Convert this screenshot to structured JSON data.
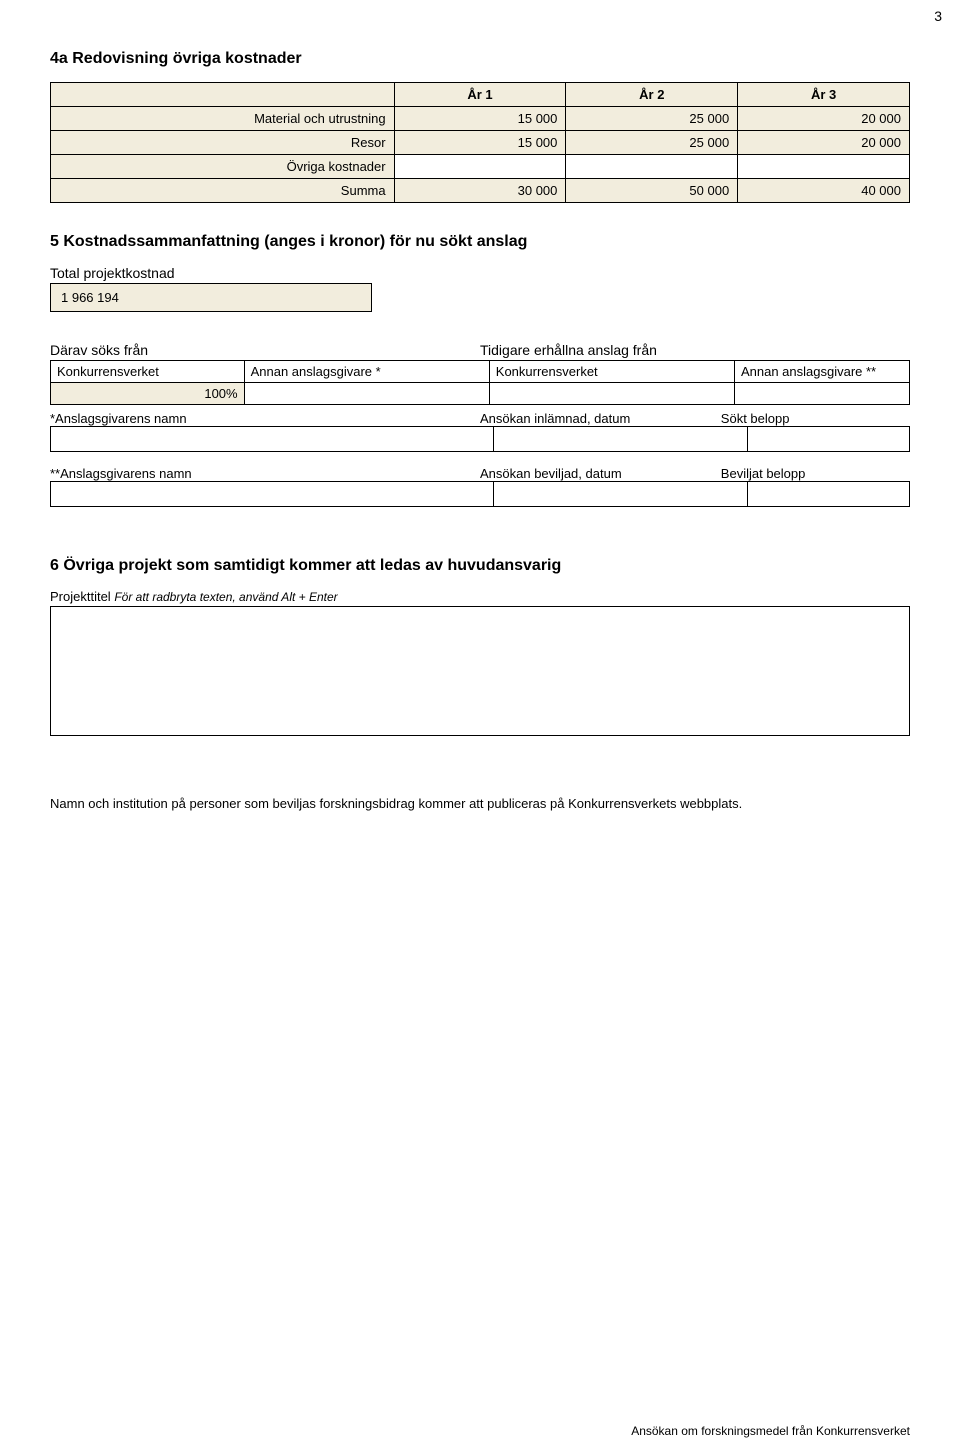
{
  "page_number": "3",
  "section_4a_title": "4a  Redovisning övriga kostnader",
  "cost_table": {
    "headers": [
      "År 1",
      "År 2",
      "År 3"
    ],
    "rows": [
      {
        "label": "Material och utrustning",
        "values": [
          "15 000",
          "25 000",
          "20 000"
        ]
      },
      {
        "label": "Resor",
        "values": [
          "15 000",
          "25 000",
          "20 000"
        ]
      },
      {
        "label": "Övriga kostnader",
        "values": [
          "",
          "",
          ""
        ]
      }
    ],
    "sum": {
      "label": "Summa",
      "values": [
        "30 000",
        "50 000",
        "40 000"
      ]
    }
  },
  "section_5_title": "5  Kostnadssammanfattning (anges i kronor) för nu sökt anslag",
  "total_cost_label": "Total projektkostnad",
  "total_cost_value": "1 966 194",
  "darav_label": "Därav söks från",
  "tidigare_label": "Tidigare erhållna anslag från",
  "alloc_headers": [
    "Konkurrensverket",
    "Annan anslagsgivare *",
    "Konkurrensverket",
    "Annan anslagsgivare **"
  ],
  "alloc_values": [
    "100%",
    "",
    "",
    ""
  ],
  "star1_labels": [
    "*Anslagsgivarens namn",
    "Ansökan inlämnad, datum",
    "Sökt belopp"
  ],
  "star1_values": [
    "",
    "",
    ""
  ],
  "star2_labels": [
    "**Anslagsgivarens namn",
    "Ansökan beviljad, datum",
    "Beviljat belopp"
  ],
  "star2_values": [
    "",
    "",
    ""
  ],
  "section_6_title": "6  Övriga projekt som samtidigt kommer att ledas av huvudansvarig",
  "section_6_help_label": "Projekttitel",
  "section_6_help_italic": "För att radbryta texten, använd Alt + Enter",
  "section_6_value": "",
  "publication_note": "Namn och institution på personer som beviljas forskningsbidrag kommer att publiceras på Konkurrensverkets webbplats.",
  "footer_text": "Ansökan om forskningsmedel från Konkurrensverket"
}
